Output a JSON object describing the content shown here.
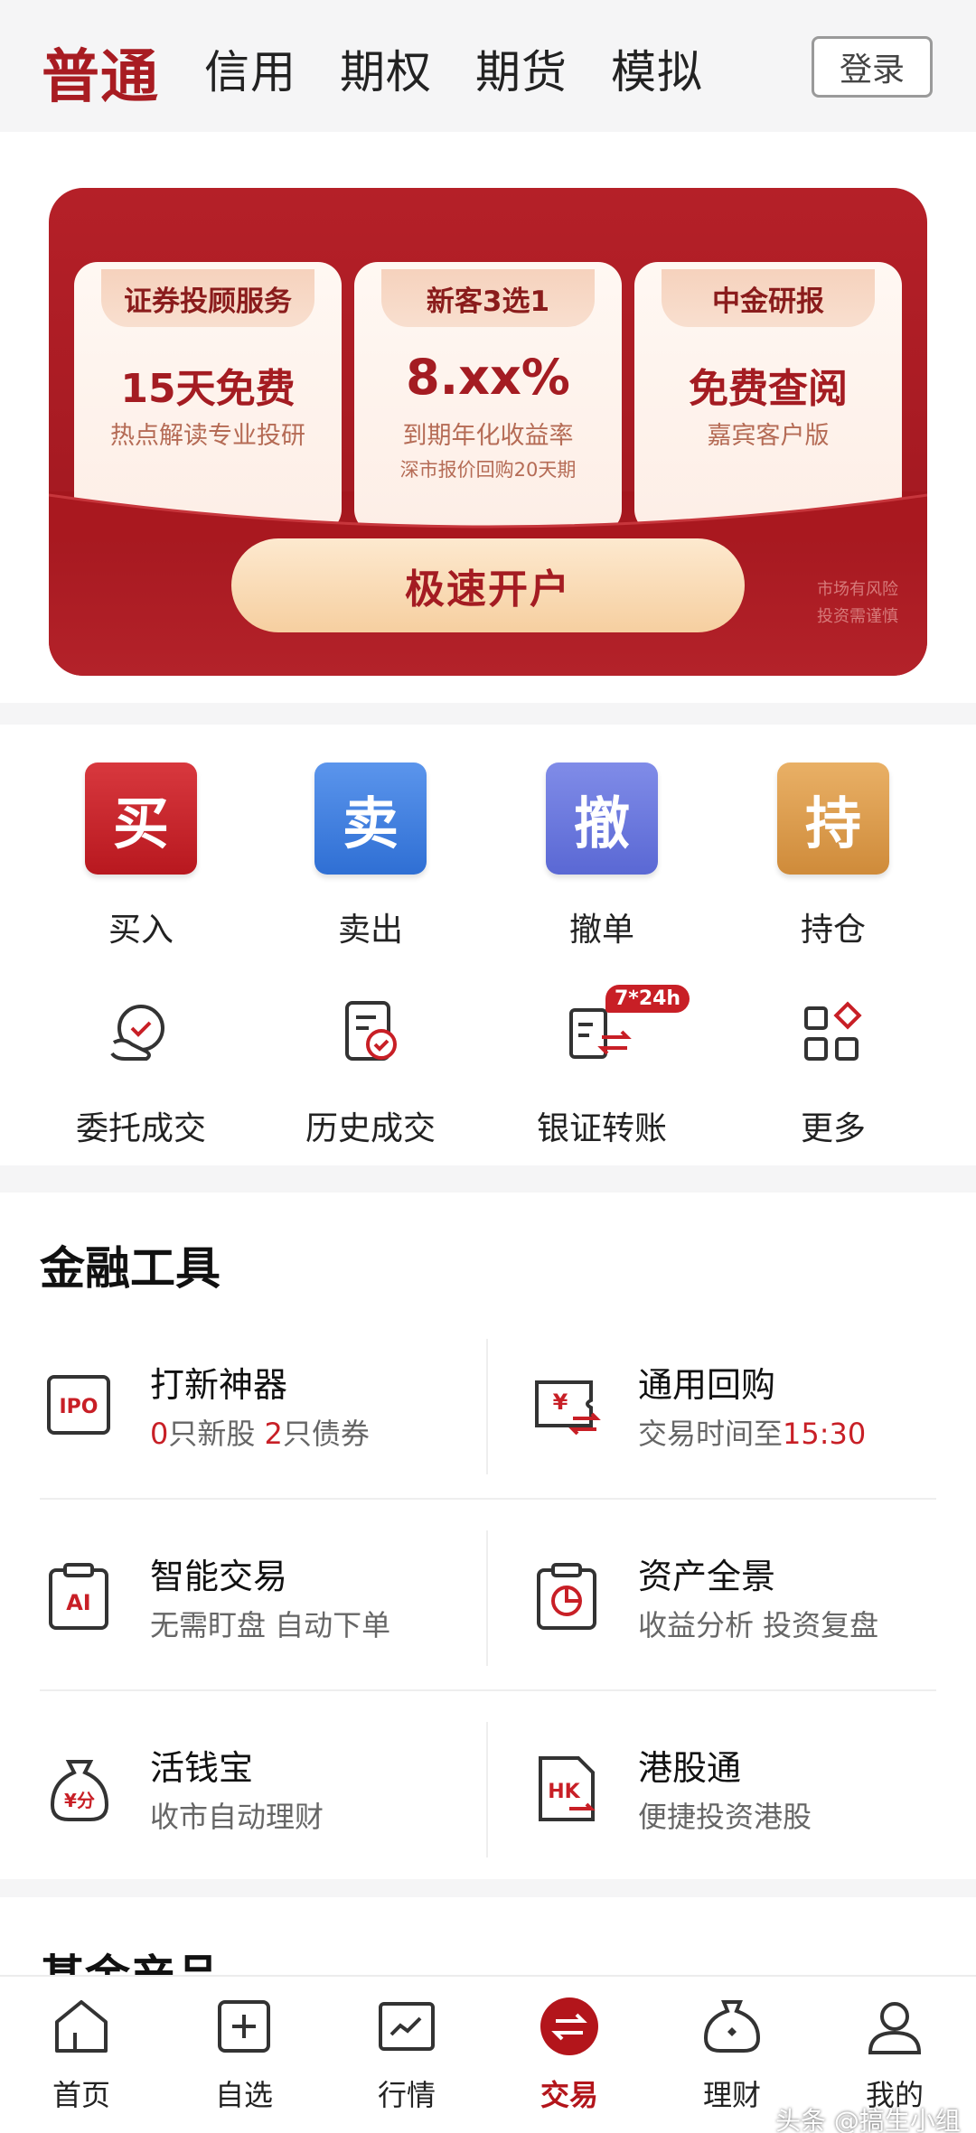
{
  "tabs": [
    {
      "label": "普通",
      "active": true
    },
    {
      "label": "信用",
      "active": false
    },
    {
      "label": "期权",
      "active": false
    },
    {
      "label": "期货",
      "active": false
    },
    {
      "label": "模拟",
      "active": false
    }
  ],
  "login_label": "登录",
  "banner": {
    "cards": [
      {
        "badge": "证券投顾服务",
        "title": "15天免费",
        "sub": "热点解读专业投研",
        "sub2": ""
      },
      {
        "badge": "新客3选1",
        "title": "8.xx%",
        "sub": "到期年化收益率",
        "sub2": "深市报价回购20天期"
      },
      {
        "badge": "中金研报",
        "title": "免费查阅",
        "sub": "嘉宾客户版",
        "sub2": ""
      }
    ],
    "cta": "极速开户",
    "risk_line1": "市场有风险",
    "risk_line2": "投资需谨慎"
  },
  "quick_actions": [
    {
      "glyph": "买",
      "label": "买入",
      "color": "#c8262d"
    },
    {
      "glyph": "卖",
      "label": "卖出",
      "color": "#3f7fe0"
    },
    {
      "glyph": "撤",
      "label": "撤单",
      "color": "#6a78dc"
    },
    {
      "glyph": "持",
      "label": "持仓",
      "color": "#d99a4a"
    }
  ],
  "secondary_actions": [
    {
      "label": "委托成交",
      "icon": "entrust-icon"
    },
    {
      "label": "历史成交",
      "icon": "history-icon"
    },
    {
      "label": "银证转账",
      "icon": "transfer-icon",
      "badge": "7*24h"
    },
    {
      "label": "更多",
      "icon": "more-grid-icon"
    }
  ],
  "tools": {
    "title": "金融工具",
    "items": [
      {
        "name": "打新神器",
        "desc_parts": [
          "0",
          "只新股 ",
          "2",
          "只债券"
        ],
        "icon": "ipo-icon",
        "icon_text": "IPO"
      },
      {
        "name": "通用回购",
        "desc_prefix": "交易时间至",
        "desc_highlight": "15:30",
        "icon": "repo-icon",
        "icon_text": "¥"
      },
      {
        "name": "智能交易",
        "desc": "无需盯盘 自动下单",
        "icon": "ai-trade-icon",
        "icon_text": "AI"
      },
      {
        "name": "资产全景",
        "desc": "收益分析 投资复盘",
        "icon": "asset-pie-icon"
      },
      {
        "name": "活钱宝",
        "desc": "收市自动理财",
        "icon": "money-bag-icon",
        "icon_text": "¥分"
      },
      {
        "name": "港股通",
        "desc": "便捷投资港股",
        "icon": "hk-stock-icon",
        "icon_text": "HK"
      }
    ]
  },
  "fund_title": "基金产品",
  "nav": [
    {
      "label": "首页",
      "icon": "home-icon",
      "active": false
    },
    {
      "label": "自选",
      "icon": "watchlist-icon",
      "active": false
    },
    {
      "label": "行情",
      "icon": "market-icon",
      "active": false
    },
    {
      "label": "交易",
      "icon": "trade-icon",
      "active": true
    },
    {
      "label": "理财",
      "icon": "wealth-icon",
      "active": false
    },
    {
      "label": "我的",
      "icon": "profile-icon",
      "active": false
    }
  ],
  "watermark": "头条 @搞生小组",
  "colors": {
    "brand_red": "#a81c22",
    "accent_red": "#c81f26"
  }
}
